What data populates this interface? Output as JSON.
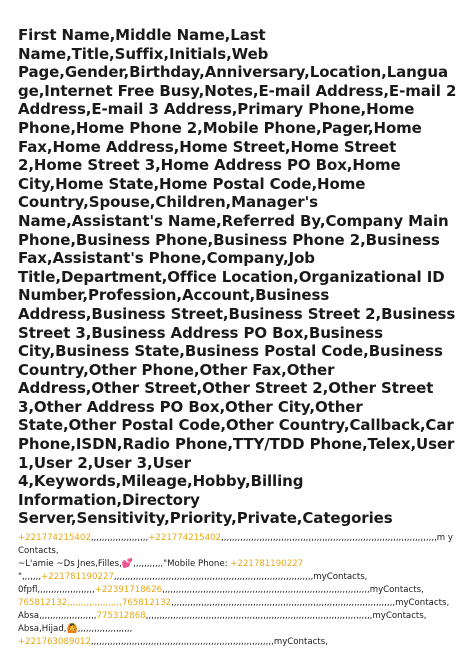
{
  "document": {
    "header_text": "First Name,Middle Name,Last Name,Title,Suffix,Initials,Web Page,Gender,Birthday,Anniversary,Location,Language,Internet Free Busy,Notes,E-mail Address,E-mail 2 Address,E-mail 3 Address,Primary Phone,Home Phone,Home Phone 2,Mobile Phone,Pager,Home Fax,Home Address,Home Street,Home Street 2,Home Street 3,Home Address PO Box,Home City,Home State,Home Postal Code,Home Country,Spouse,Children,Manager's Name,Assistant's Name,Referred By,Company Main Phone,Business Phone,Business Phone 2,Business Fax,Assistant's Phone,Company,Job Title,Department,Office Location,Organizational ID Number,Profession,Account,Business Address,Business Street,Business Street 2,Business Street 3,Business Address PO Box,Business City,Business State,Business Postal Code,Business Country,Other Phone,Other Fax,Other Address,Other Street,Other Street 2,Other Street 3,Other Address PO Box,Other City,Other State,Other Postal Code,Other Country,Callback,Car Phone,ISDN,Radio Phone,TTY/TDD Phone,Telex,User 1,User 2,User 3,User 4,Keywords,Mileage,Hobby,Billing Information,Directory Server,Sensitivity,Priority,Private,Categories",
    "rows": [
      {
        "phone_a": "+221774215402",
        "mid_a": ",,,,,,,,,,,,,,,,,,,,,",
        "phone_b": "+221774215402",
        "rest": ",,,,,,,,,,,,,,,,,,,,,,,,,,,,,,,,,,,,,,,,,,,,,,,,,,,,,,,,,,,,,,,,,,,,,,,,,,,,,,,m yContacts,"
      },
      {
        "pre": "~L'amie ~Ds Jnes,Filles,",
        "emoji": "💕",
        "mid": ",,,,,,,,,,,\"Mobile Phone: ",
        "phone": "+221781190227",
        "rest": ""
      },
      {
        "pre": "\",,,,,,,",
        "phone": "+221781190227",
        "rest": ",,,,,,,,,,,,,,,,,,,,,,,,,,,,,,,,,,,,,,,,,,,,,,,,,,,,,,,,,,,,,,,,,,,,,,,,,myContacts,"
      },
      {
        "pre": "0fpfl,,,,,,,,,,,,,,,,,,,,,",
        "phone": "+22391718626",
        "rest": ",,,,,,,,,,,,,,,,,,,,,,,,,,,,,,,,,,,,,,,,,,,,,,,,,,,,,,,,,,,,,,,,,,,,,,,,,,,,myContacts,"
      },
      {
        "phone_a": "765812132",
        "mid_a": ",,,,,,,,,,,,,,,,,,,,",
        "phone_b": "765812132",
        "rest": ",,,,,,,,,,,,,,,,,,,,,,,,,,,,,,,,,,,,,,,,,,,,,,,,,,,,,,,,,,,,,,,,,,,,,,,,,,,,,,,,,,myContacts,"
      },
      {
        "pre": "Absa,,,,,,,,,,,,,,,,,,,,,",
        "phone": "775312868",
        "rest": ",,,,,,,,,,,,,,,,,,,,,,,,,,,,,,,,,,,,,,,,,,,,,,,,,,,,,,,,,,,,,,,,,,,,,,,,,,,,,,,,,,,myContacts,"
      },
      {
        "pre": "Absa,Hijad,",
        "emoji": "🙆",
        "mid": ",,,,,,,,,,,,,,,,,,,,",
        "phone": "",
        "rest": ""
      },
      {
        "pre": "",
        "phone": "+221763089012",
        "rest": ",,,,,,,,,,,,,,,,,,,,,,,,,,,,,,,,,,,,,,,,,,,,,,,,,,,,,,,,,,,,,,,,,,,myContacts,"
      }
    ],
    "accent_color": "#e6a817"
  }
}
